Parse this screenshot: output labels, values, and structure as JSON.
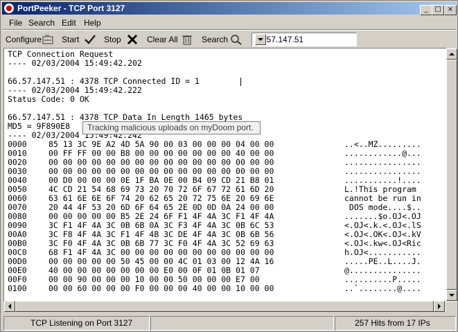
{
  "window": {
    "title": "PortPeeker - TCP Port 3127"
  },
  "title_buttons": {
    "minimize": "_",
    "maximize": "□",
    "close": "×"
  },
  "menu": [
    "File",
    "Search",
    "Edit",
    "Help"
  ],
  "toolbar": {
    "configure": "Configure",
    "start": "Start",
    "stop": "Stop",
    "clear_all": "Clear All",
    "search": "Search",
    "address": "66.57.147.51"
  },
  "log": [
    "TCP Connection Request",
    "---- 02/03/2004 15:49:42.202",
    "",
    "66.57.147.51 : 4378 TCP Connected ID = 1",
    "---- 02/03/2004 15:49:42.222",
    "Status Code: 0 OK",
    "",
    "66.57.147.51 : 4378 TCP Data In Length 1465 bytes",
    "MD5 = 9F890E8",
    "---- 02/03/2004 15:49:42.242"
  ],
  "tooltip": "Tracking malicious uploads on myDoom port.",
  "hex_rows": [
    {
      "addr": "0000",
      "bytes": "85 13 3C 9E A2 4D 5A 90 00 03 00 00 00 04 00 00",
      "ascii": "..<..MZ........."
    },
    {
      "addr": "0010",
      "bytes": "00 FF FF 00 00 B8 00 00 00 00 00 00 00 40 00 00",
      "ascii": "............@..."
    },
    {
      "addr": "0020",
      "bytes": "00 00 00 00 00 00 00 00 00 00 00 00 00 00 00 00",
      "ascii": "................"
    },
    {
      "addr": "0030",
      "bytes": "00 00 00 00 00 00 00 00 00 00 00 00 00 00 00 00",
      "ascii": "................"
    },
    {
      "addr": "0040",
      "bytes": "00 D0 00 00 00 0E 1F BA 0E 00 B4 09 CD 21 B8 01",
      "ascii": "...........!...."
    },
    {
      "addr": "0050",
      "bytes": "4C CD 21 54 68 69 73 20 70 72 6F 67 72 61 6D 20",
      "ascii": "L.!This program "
    },
    {
      "addr": "0060",
      "bytes": "63 61 6E 6E 6F 74 20 62 65 20 72 75 6E 20 69 6E",
      "ascii": "cannot be run in"
    },
    {
      "addr": "0070",
      "bytes": "20 44 4F 53 20 6D 6F 64 65 2E 0D 0D 0A 24 00 00",
      "ascii": " DOS mode....$.."
    },
    {
      "addr": "0080",
      "bytes": "00 00 00 00 00 B5 2E 24 6F F1 4F 4A 3C F1 4F 4A",
      "ascii": ".......$o.OJ<.OJ"
    },
    {
      "addr": "0090",
      "bytes": "3C F1 4F 4A 3C 0B 6B 0A 3C F3 4F 4A 3C 0B 6C 53",
      "ascii": "<.OJ<.k.<.OJ<.lS"
    },
    {
      "addr": "00A0",
      "bytes": "3C F8 4F 4A 3C F1 4F 4B 3C DE 4F 4A 3C 0B 6B 56",
      "ascii": "<.OJ<.OK<.OJ<.kV"
    },
    {
      "addr": "00B0",
      "bytes": "3C F0 4F 4A 3C 0B 6B 77 3C F0 4F 4A 3C 52 69 63",
      "ascii": "<.OJ<.kw<.OJ<Ric"
    },
    {
      "addr": "00C0",
      "bytes": "68 F1 4F 4A 3C 00 00 00 00 00 00 00 00 00 00 00",
      "ascii": "h.OJ<..........."
    },
    {
      "addr": "00D0",
      "bytes": "00 00 00 00 00 50 45 00 00 4C 01 03 00 12 4A 16",
      "ascii": ".....PE..L....J."
    },
    {
      "addr": "00E0",
      "bytes": "40 00 00 00 00 00 00 00 E0 00 0F 01 0B 01 07",
      "ascii": "@..............."
    },
    {
      "addr": "00F0",
      "bytes": "00 00 90 00 00 00 10 00 00 50 00 00 00 E7 00",
      "ascii": "..........P....."
    },
    {
      "addr": "0100",
      "bytes": "00 00 60 00 00 00 F0 00 00 00 40 00 00 10 00 00",
      "ascii": "..`........@...."
    }
  ],
  "status": {
    "listening": "TCP Listening on Port 3127",
    "middle": "",
    "hits": "257 Hits from 17 IPs"
  }
}
